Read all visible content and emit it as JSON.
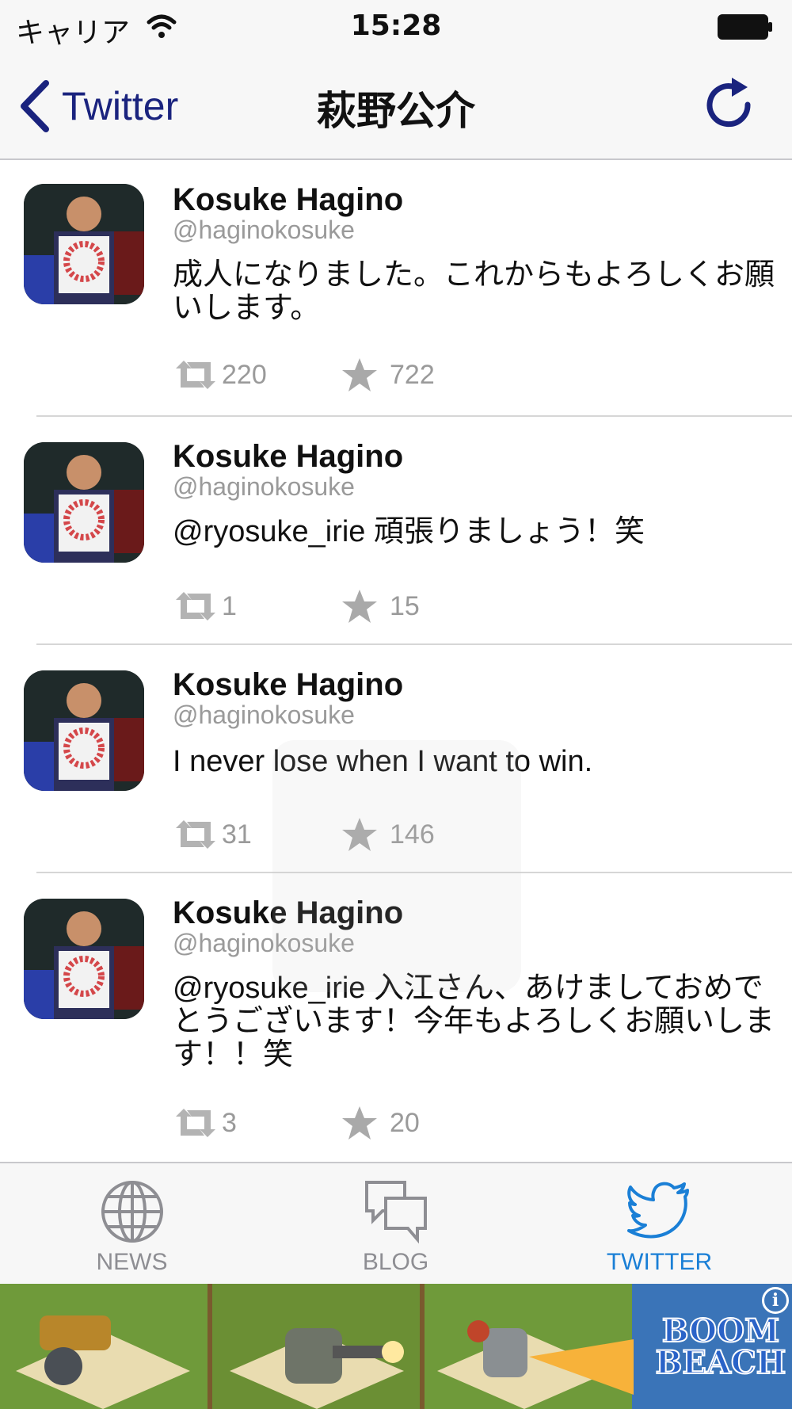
{
  "status_bar": {
    "carrier": "キャリア",
    "time": "15:28"
  },
  "nav": {
    "back_label": "Twitter",
    "title": "萩野公介"
  },
  "tweets": [
    {
      "name": "Kosuke Hagino",
      "handle": "@haginokosuke",
      "text": "成人になりました。これからもよろしくお願いします。",
      "retweets": "220",
      "favorites": "722"
    },
    {
      "name": "Kosuke Hagino",
      "handle": "@haginokosuke",
      "text": "@ryosuke_irie 頑張りましょう！笑",
      "retweets": "1",
      "favorites": "15"
    },
    {
      "name": "Kosuke Hagino",
      "handle": "@haginokosuke",
      "text": "I never lose when I want to win.",
      "retweets": "31",
      "favorites": "146"
    },
    {
      "name": "Kosuke Hagino",
      "handle": "@haginokosuke",
      "text": "@ryosuke_irie 入江さん、あけましておめでとうございます！今年もよろしくお願いします！！笑",
      "retweets": "3",
      "favorites": "20"
    }
  ],
  "tabs": [
    {
      "label": "NEWS",
      "icon": "globe-icon",
      "active": false
    },
    {
      "label": "BLOG",
      "icon": "chat-bubbles-icon",
      "active": false
    },
    {
      "label": "TWITTER",
      "icon": "twitter-bird-icon",
      "active": true
    }
  ],
  "ad": {
    "brand_line1": "BOOM",
    "brand_line2": "BEACH",
    "info_glyph": "i"
  },
  "colors": {
    "accent": "#1a237e",
    "tab_active": "#1a7fd6",
    "secondary_text": "#9a9a9a"
  }
}
